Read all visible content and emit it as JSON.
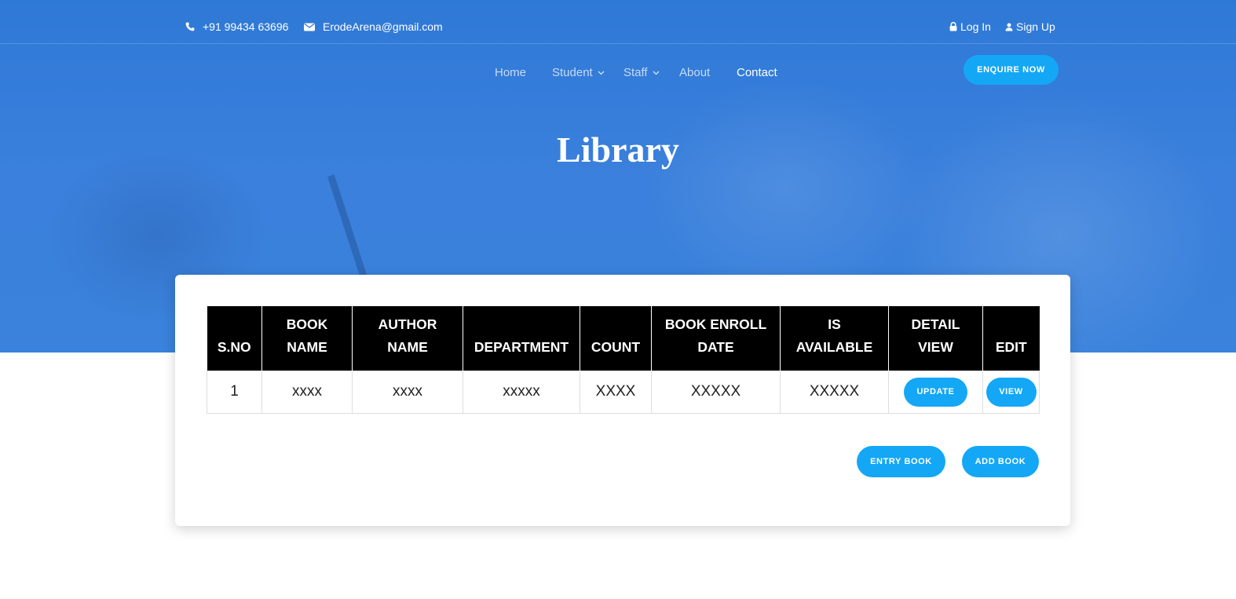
{
  "topbar": {
    "phone": "+91 99434 63696",
    "email": "ErodeArena@gmail.com",
    "login": "Log In",
    "signup": "Sign Up"
  },
  "nav": {
    "home": "Home",
    "student": "Student",
    "staff": "Staff",
    "about": "About",
    "contact": "Contact",
    "enquire": "ENQUIRE NOW"
  },
  "page": {
    "title": "Library"
  },
  "table": {
    "headers": [
      [
        "S.NO"
      ],
      [
        "BOOK",
        "NAME"
      ],
      [
        "AUTHOR",
        "NAME"
      ],
      [
        "DEPARTMENT"
      ],
      [
        "COUNT"
      ],
      [
        "BOOK ENROLL",
        "DATE"
      ],
      [
        "IS",
        "AVAILABLE"
      ],
      [
        "DETAIL",
        "VIEW"
      ],
      [
        "EDIT"
      ]
    ],
    "rows": [
      {
        "sno": "1",
        "book_name": "xxxx",
        "author_name": "xxxx",
        "department": "xxxxx",
        "count": "XXXX",
        "enroll_date": "XXXXX",
        "is_available": "XXXXX",
        "detail_button": "UPDATE",
        "edit_button": "VIEW"
      }
    ]
  },
  "actions": {
    "entry_book": "ENTRY BOOK",
    "add_book": "ADD BOOK"
  },
  "colors": {
    "hero_blue": "#3a80dc",
    "button_blue": "#14a7f5",
    "table_header": "#000000"
  }
}
